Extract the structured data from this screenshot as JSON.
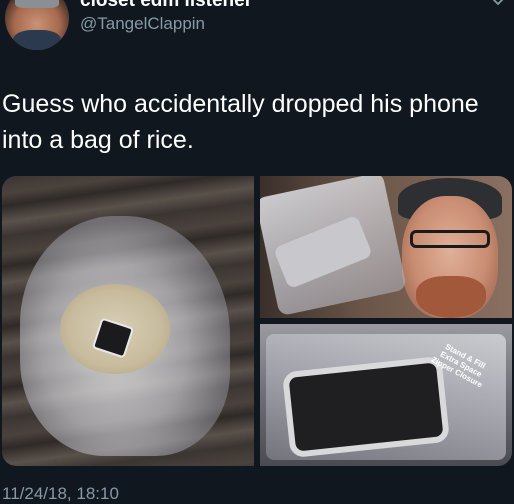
{
  "tweet": {
    "display_name": "closet edm listener",
    "handle": "@TangelClappin",
    "text": "Guess who accidentally dropped his phone into a bag of rice.",
    "timestamp": "11/24/18, 18:10",
    "photo_bag_label": "Stand & Fill Extra Space Zipper Closure"
  },
  "colors": {
    "background": "#10171e",
    "text": "#ffffff",
    "secondary_text": "#8899a6"
  },
  "icons": {
    "menu": "chevron-down-icon"
  }
}
